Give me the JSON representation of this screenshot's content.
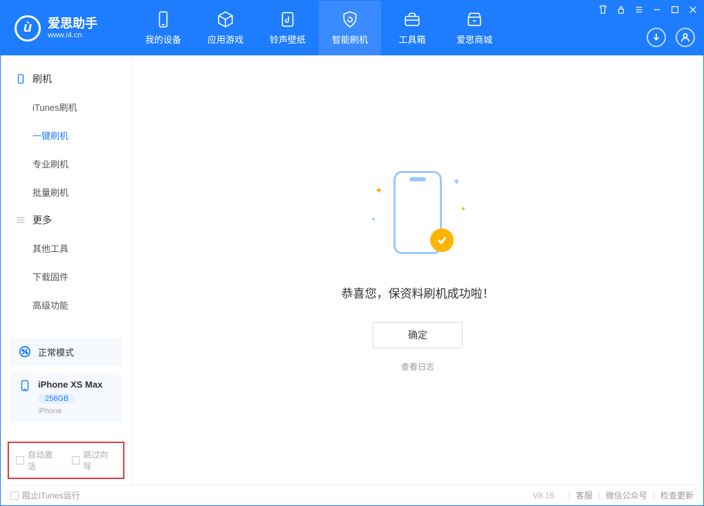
{
  "app": {
    "name": "爱思助手",
    "site": "www.i4.cn"
  },
  "nav": {
    "items": [
      {
        "label": "我的设备"
      },
      {
        "label": "应用游戏"
      },
      {
        "label": "铃声壁纸"
      },
      {
        "label": "智能刷机"
      },
      {
        "label": "工具箱"
      },
      {
        "label": "爱思商城"
      }
    ]
  },
  "sidebar": {
    "group1": {
      "title": "刷机",
      "items": [
        {
          "label": "iTunes刷机"
        },
        {
          "label": "一键刷机"
        },
        {
          "label": "专业刷机"
        },
        {
          "label": "批量刷机"
        }
      ]
    },
    "group2": {
      "title": "更多",
      "items": [
        {
          "label": "其他工具"
        },
        {
          "label": "下载固件"
        },
        {
          "label": "高级功能"
        }
      ]
    },
    "mode": "正常模式",
    "device": {
      "name": "iPhone XS Max",
      "storage": "256GB",
      "type": "iPhone"
    },
    "checks": {
      "auto_activate": "自动激活",
      "skip_guide": "跳过向导"
    }
  },
  "main": {
    "success_msg": "恭喜您，保资料刷机成功啦！",
    "ok": "确定",
    "view_log": "查看日志"
  },
  "footer": {
    "block_itunes": "阻止iTunes运行",
    "version": "V8.16",
    "links": {
      "service": "客服",
      "wechat": "微信公众号",
      "update": "检查更新"
    }
  }
}
